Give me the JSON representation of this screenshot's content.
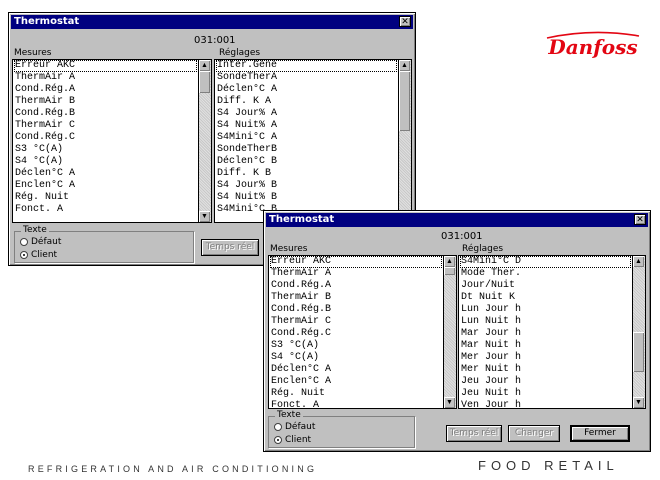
{
  "brand": {
    "logo_text": "Danfoss",
    "logo_color": "#e30613",
    "footer_left": "REFRIGERATION AND AIR CONDITIONING",
    "footer_right": "FOOD RETAIL"
  },
  "window_back": {
    "title": "Thermostat",
    "close_icon": "close-icon",
    "device_id": "031:001",
    "mesures_label": "Mesures",
    "reglages_label": "Réglages",
    "mesures": [
      "Erreur AKC",
      "ThermAir A",
      "Cond.Rég.A",
      "ThermAir B",
      "Cond.Rég.B",
      "ThermAir C",
      "Cond.Rég.C",
      "S3 °C(A)",
      "S4 °C(A)",
      "Déclen°C A",
      "Enclen°C A",
      "Rég. Nuit",
      "Fonct. A"
    ],
    "reglages": [
      "Inter.Géné",
      "SondeTherA",
      "Déclen°C A",
      "Diff. K A",
      "S4 Jour% A",
      "S4 Nuit% A",
      "S4Mini°C A",
      "SondeTherB",
      "Déclen°C B",
      "Diff. K B",
      "S4 Jour% B",
      "S4 Nuit% B",
      "S4Mini°C B"
    ],
    "texte_group_label": "Texte",
    "radio_defaut": "Défaut",
    "radio_client": "Client",
    "selected_radio": "Client",
    "temps_reel_button": "Temps réel"
  },
  "window_front": {
    "title": "Thermostat",
    "close_icon": "close-icon",
    "device_id": "031:001",
    "mesures_label": "Mesures",
    "reglages_label": "Réglages",
    "mesures": [
      "Erreur AKC",
      "ThermAir A",
      "Cond.Rég.A",
      "ThermAir B",
      "Cond.Rég.B",
      "ThermAir C",
      "Cond.Rég.C",
      "S3 °C(A)",
      "S4 °C(A)",
      "Déclen°C A",
      "Enclen°C A",
      "Rég. Nuit",
      "Fonct. A"
    ],
    "reglages": [
      "S4Mini°C D",
      "Mode Ther.",
      "Jour/Nuit",
      "Dt Nuit K",
      "Lun Jour h",
      "Lun Nuit h",
      "Mar Jour h",
      "Mar Nuit h",
      "Mer Jour h",
      "Mer Nuit h",
      "Jeu Jour h",
      "Jeu Nuit h",
      "Ven Jour h"
    ],
    "texte_group_label": "Texte",
    "radio_defaut": "Défaut",
    "radio_client": "Client",
    "selected_radio": "Client",
    "temps_reel_button": "Temps réel",
    "changer_button": "Changer",
    "fermer_button": "Fermer"
  }
}
